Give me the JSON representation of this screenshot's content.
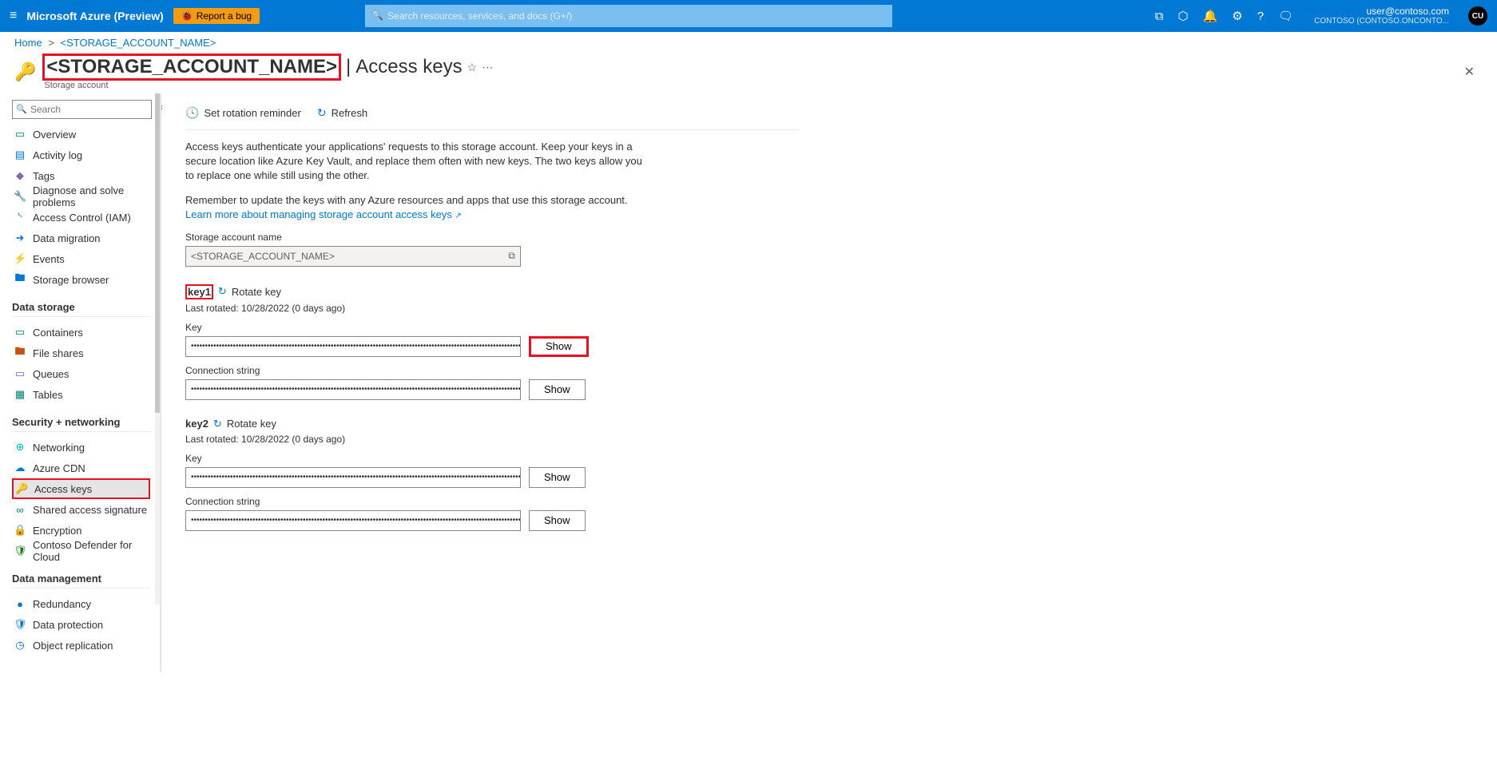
{
  "topbar": {
    "brand": "Microsoft Azure (Preview)",
    "reportBug": "Report a bug",
    "searchPlaceholder": "Search resources, services, and docs (G+/)",
    "userEmail": "user@contoso.com",
    "userDir": "CONTOSO (CONTOSO.ONCONTO...",
    "avatar": "CU"
  },
  "breadcrumb": {
    "home": "Home",
    "resource": "<STORAGE_ACCOUNT_NAME>"
  },
  "page": {
    "title": "<STORAGE_ACCOUNT_NAME>",
    "subtitle": "Access keys",
    "resourceType": "Storage account"
  },
  "sidebar": {
    "searchPlaceholder": "Search",
    "items": [
      {
        "icon": "▭",
        "label": "Overview",
        "cls": "c-teal"
      },
      {
        "icon": "▤",
        "label": "Activity log",
        "cls": "c-blue"
      },
      {
        "icon": "◆",
        "label": "Tags",
        "cls": "c-purple"
      },
      {
        "icon": "🔧",
        "label": "Diagnose and solve problems",
        "cls": "c-gray"
      },
      {
        "icon": "ᔅ",
        "label": "Access Control (IAM)",
        "cls": "c-blue"
      },
      {
        "icon": "➜",
        "label": "Data migration",
        "cls": "c-blue"
      },
      {
        "icon": "⚡",
        "label": "Events",
        "cls": "c-yellow"
      },
      {
        "icon": "🖿",
        "label": "Storage browser",
        "cls": "c-blue"
      }
    ],
    "group1": "Data storage",
    "items1": [
      {
        "icon": "▭",
        "label": "Containers",
        "cls": "c-teal"
      },
      {
        "icon": "🖿",
        "label": "File shares",
        "cls": "c-orange"
      },
      {
        "icon": "▭",
        "label": "Queues",
        "cls": "c-purple"
      },
      {
        "icon": "▦",
        "label": "Tables",
        "cls": "c-teal"
      }
    ],
    "group2": "Security + networking",
    "items2": [
      {
        "icon": "⊕",
        "label": "Networking",
        "cls": "c-cyan"
      },
      {
        "icon": "☁",
        "label": "Azure CDN",
        "cls": "c-blue"
      },
      {
        "icon": "🔑",
        "label": "Access keys",
        "cls": "c-yellow",
        "sel": true
      },
      {
        "icon": "∞",
        "label": "Shared access signature",
        "cls": "c-teal"
      },
      {
        "icon": "🔒",
        "label": "Encryption",
        "cls": "c-blue"
      },
      {
        "icon": "🛡",
        "label": "Contoso Defender for Cloud",
        "cls": "c-green"
      }
    ],
    "group3": "Data management",
    "items3": [
      {
        "icon": "●",
        "label": "Redundancy",
        "cls": "c-blue"
      },
      {
        "icon": "🛡",
        "label": "Data protection",
        "cls": "c-blue"
      },
      {
        "icon": "◷",
        "label": "Object replication",
        "cls": "c-blue"
      }
    ]
  },
  "toolbar": {
    "rotationReminder": "Set rotation reminder",
    "refresh": "Refresh"
  },
  "info": {
    "p1": "Access keys authenticate your applications' requests to this storage account. Keep your keys in a secure location like Azure Key Vault, and replace them often with new keys. The two keys allow you to replace one while still using the other.",
    "p2": "Remember to update the keys with any Azure resources and apps that use this storage account.",
    "link": "Learn more about managing storage account access keys"
  },
  "acct": {
    "label": "Storage account name",
    "value": "<STORAGE_ACCOUNT_NAME>"
  },
  "keys": {
    "rotate": "Rotate key",
    "keyLabel": "Key",
    "connLabel": "Connection string",
    "show": "Show",
    "mask": "•••••••••••••••••••••••••••••••••••••••••••••••••••••••••••••••••••••••••••••••••••••••••••••••••••••••••••••••••••••••••••",
    "maskLong": "••••••••••••••••••••••••••••••••••••••••••••••••••••••••••••••••••••••••••••••••••••••••••••••••••••••••••••••••••••••••...",
    "k1": {
      "name": "key1",
      "meta": "Last rotated: 10/28/2022 (0 days ago)"
    },
    "k2": {
      "name": "key2",
      "meta": "Last rotated: 10/28/2022 (0 days ago)"
    }
  }
}
